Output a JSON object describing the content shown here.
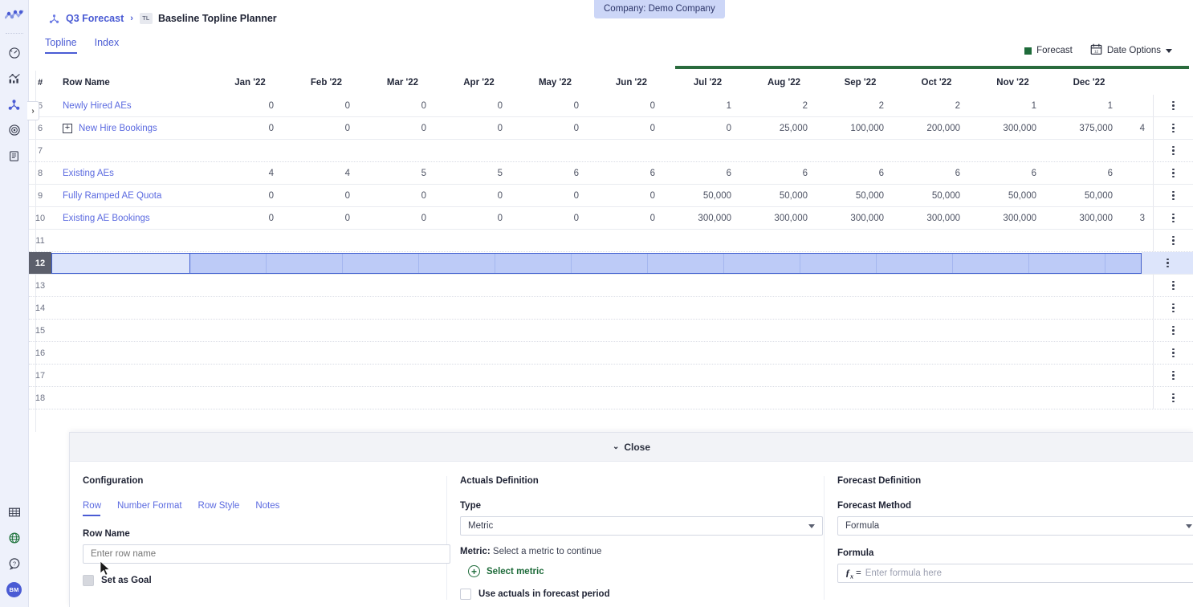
{
  "rail": {
    "logo_name": "app-logo",
    "items": [
      {
        "name": "dashboard",
        "icon": "gauge-icon"
      },
      {
        "name": "analytics",
        "icon": "bar-line-chart-icon"
      },
      {
        "name": "models",
        "icon": "node-graph-icon",
        "active": true
      },
      {
        "name": "targets",
        "icon": "target-icon"
      },
      {
        "name": "reports",
        "icon": "document-icon"
      }
    ],
    "bottom_items": [
      {
        "name": "spreadsheet",
        "icon": "grid-icon"
      },
      {
        "name": "integrations",
        "icon": "globe-icon"
      },
      {
        "name": "help",
        "icon": "question-icon"
      },
      {
        "name": "user-avatar",
        "icon": "avatar-icon",
        "initials": "BM"
      }
    ],
    "expander_glyph": "›"
  },
  "company_pill": "Company: Demo Company",
  "breadcrumb": {
    "parent": "Q3 Forecast",
    "separator": "›",
    "badge": "TL",
    "title": "Baseline Topline Planner"
  },
  "tabs": [
    {
      "label": "Topline",
      "active": true
    },
    {
      "label": "Index",
      "active": false
    }
  ],
  "toolbar": {
    "legend_label": "Forecast",
    "legend_color": "#1e6b3a",
    "date_options_label": "Date Options"
  },
  "grid": {
    "headers": [
      "#",
      "Row Name",
      "Jan '22",
      "Feb '22",
      "Mar '22",
      "Apr '22",
      "May '22",
      "Jun '22",
      "Jul '22",
      "Aug '22",
      "Sep '22",
      "Oct '22",
      "Nov '22",
      "Dec '22"
    ],
    "clipped_header": "",
    "forecast_start_column": "Jul '22",
    "rows": [
      {
        "num": "5",
        "name": "Newly Hired AEs",
        "expandable": false,
        "values": [
          "0",
          "0",
          "0",
          "0",
          "0",
          "0",
          "1",
          "2",
          "2",
          "2",
          "1",
          "1"
        ],
        "clipped": ""
      },
      {
        "num": "6",
        "name": "New Hire Bookings",
        "expandable": true,
        "values": [
          "0",
          "0",
          "0",
          "0",
          "0",
          "0",
          "0",
          "25,000",
          "100,000",
          "200,000",
          "300,000",
          "375,000"
        ],
        "clipped": "4"
      },
      {
        "num": "7",
        "name": "",
        "expandable": false,
        "values": [
          "",
          "",
          "",
          "",
          "",
          "",
          "",
          "",
          "",
          "",
          "",
          ""
        ],
        "clipped": ""
      },
      {
        "num": "8",
        "name": "Existing AEs",
        "expandable": false,
        "values": [
          "4",
          "4",
          "5",
          "5",
          "6",
          "6",
          "6",
          "6",
          "6",
          "6",
          "6",
          "6"
        ],
        "clipped": ""
      },
      {
        "num": "9",
        "name": "Fully Ramped AE Quota",
        "expandable": false,
        "values": [
          "0",
          "0",
          "0",
          "0",
          "0",
          "0",
          "50,000",
          "50,000",
          "50,000",
          "50,000",
          "50,000",
          "50,000"
        ],
        "clipped": ""
      },
      {
        "num": "10",
        "name": "Existing AE Bookings",
        "expandable": false,
        "values": [
          "0",
          "0",
          "0",
          "0",
          "0",
          "0",
          "300,000",
          "300,000",
          "300,000",
          "300,000",
          "300,000",
          "300,000"
        ],
        "clipped": "3"
      },
      {
        "num": "11",
        "name": "",
        "expandable": false,
        "values": [
          "",
          "",
          "",
          "",
          "",
          "",
          "",
          "",
          "",
          "",
          "",
          ""
        ],
        "clipped": ""
      },
      {
        "num": "12",
        "name": "",
        "expandable": false,
        "selected": true,
        "values": [
          "",
          "",
          "",
          "",
          "",
          "",
          "",
          "",
          "",
          "",
          "",
          ""
        ],
        "clipped": ""
      },
      {
        "num": "13",
        "name": "",
        "expandable": false,
        "values": [
          "",
          "",
          "",
          "",
          "",
          "",
          "",
          "",
          "",
          "",
          "",
          ""
        ],
        "clipped": ""
      },
      {
        "num": "14",
        "name": "",
        "expandable": false,
        "values": [
          "",
          "",
          "",
          "",
          "",
          "",
          "",
          "",
          "",
          "",
          "",
          ""
        ],
        "clipped": ""
      },
      {
        "num": "15",
        "name": "",
        "expandable": false,
        "values": [
          "",
          "",
          "",
          "",
          "",
          "",
          "",
          "",
          "",
          "",
          "",
          ""
        ],
        "clipped": ""
      },
      {
        "num": "16",
        "name": "",
        "expandable": false,
        "values": [
          "",
          "",
          "",
          "",
          "",
          "",
          "",
          "",
          "",
          "",
          "",
          ""
        ],
        "clipped": ""
      },
      {
        "num": "17",
        "name": "",
        "expandable": false,
        "values": [
          "",
          "",
          "",
          "",
          "",
          "",
          "",
          "",
          "",
          "",
          "",
          ""
        ],
        "clipped": ""
      },
      {
        "num": "18",
        "name": "",
        "expandable": false,
        "values": [
          "",
          "",
          "",
          "",
          "",
          "",
          "",
          "",
          "",
          "",
          "",
          ""
        ],
        "clipped": ""
      }
    ]
  },
  "panel": {
    "close_label": "Close",
    "close_glyph": "⌄",
    "configuration": {
      "title": "Configuration",
      "tabs": [
        {
          "label": "Row",
          "active": true
        },
        {
          "label": "Number Format",
          "active": false
        },
        {
          "label": "Row Style",
          "active": false
        },
        {
          "label": "Notes",
          "active": false
        }
      ],
      "row_name_label": "Row Name",
      "row_name_placeholder": "Enter row name",
      "row_name_value": "",
      "set_as_goal_label": "Set as Goal",
      "set_as_goal_checked": false
    },
    "actuals": {
      "title": "Actuals Definition",
      "type_label": "Type",
      "type_value": "Metric",
      "metric_label": "Metric:",
      "metric_hint": "Select a metric to continue",
      "select_metric_label": "Select metric",
      "use_actuals_label": "Use actuals in forecast period",
      "use_actuals_checked": false
    },
    "forecast": {
      "title": "Forecast Definition",
      "method_label": "Forecast Method",
      "method_value": "Formula",
      "formula_label": "Formula",
      "formula_prefix": "=",
      "formula_placeholder": "Enter formula here",
      "formula_value": ""
    }
  }
}
